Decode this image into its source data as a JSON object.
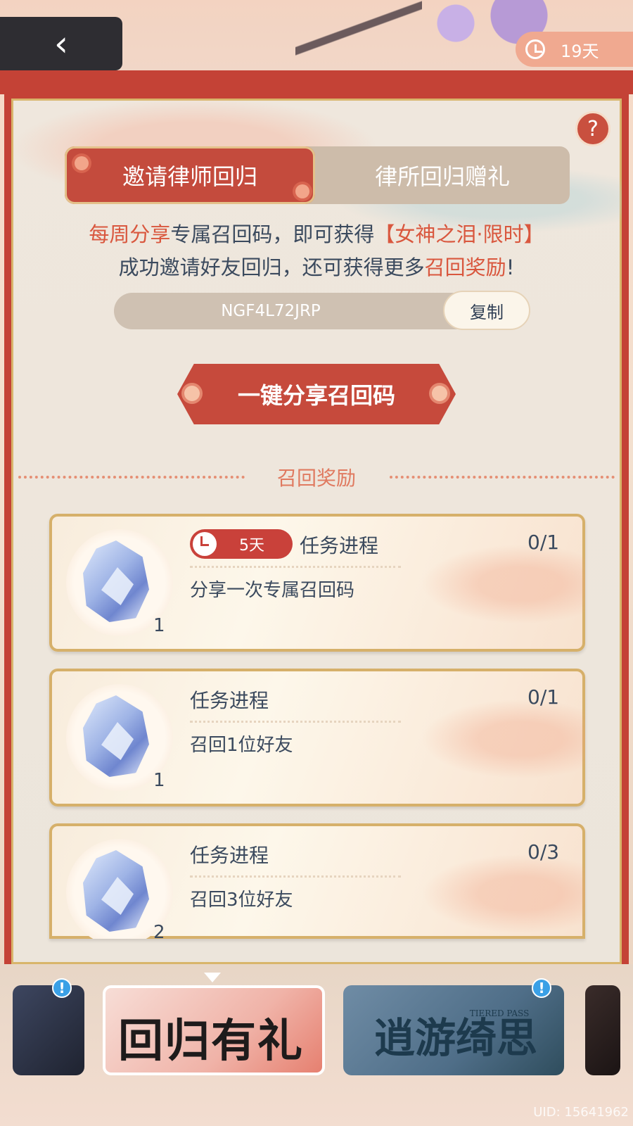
{
  "header": {
    "back_icon": "chevron-left-icon",
    "timer_icon": "clock-icon",
    "timer_text": "19天"
  },
  "help_label": "?",
  "tabs": [
    {
      "label": "邀请律师回归",
      "active": true
    },
    {
      "label": "律所回归赠礼",
      "active": false
    }
  ],
  "description": {
    "line1_part1": "每周分享",
    "line1_part2": "专属召回码，即可获得",
    "line1_part3": "【女神之泪·限时】",
    "line2_part1": "成功邀请好友回归，还可获得更多",
    "line2_part2": "召回奖励",
    "line2_part3": "!"
  },
  "invite": {
    "code": "NGF4L72JRP",
    "copy_label": "复制",
    "share_label": "一键分享召回码"
  },
  "rewards_title": "召回奖励",
  "tasks": [
    {
      "badge": "5天",
      "label": "任务进程",
      "progress": "0/1",
      "task": "分享一次专属召回码",
      "reward_count": "1"
    },
    {
      "label": "任务进程",
      "progress": "0/1",
      "task": "召回1位好友",
      "reward_count": "1"
    },
    {
      "label": "任务进程",
      "progress": "0/3",
      "task": "召回3位好友",
      "reward_count": "2"
    }
  ],
  "bottom": {
    "thumb2_title": "回归有礼",
    "thumb3_title": "逍游绮思",
    "thumb3_sub": "TIERED PASS",
    "alert_mark": "!",
    "uid": "UID: 15641962"
  },
  "colors": {
    "primary_red": "#c44b3d",
    "accent_orange": "#d9573e",
    "text_dark": "#3b4a5e",
    "gold": "#d6b06a"
  }
}
